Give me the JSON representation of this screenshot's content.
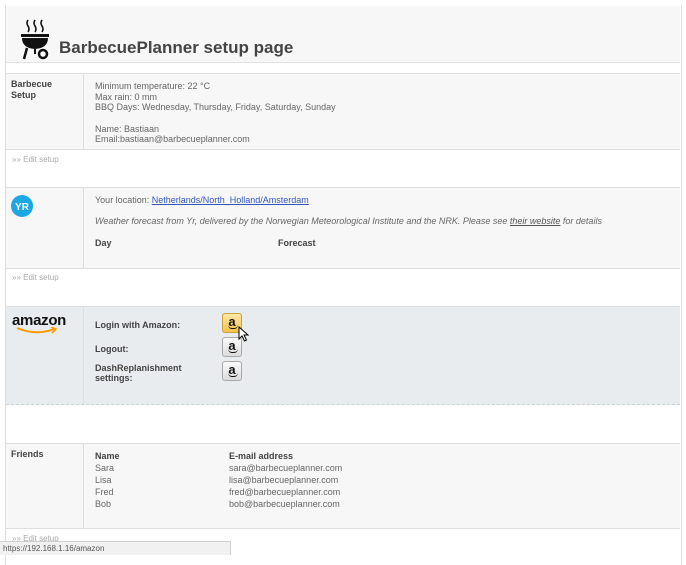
{
  "header": {
    "title": "BarbecuePlanner setup page",
    "icon": "grill-icon"
  },
  "barbecue": {
    "label": "Barbecue Setup",
    "min_temp": "Minimum temperature: 22 °C",
    "max_rain": "Max rain: 0 mm",
    "bbq_days": "BBQ Days: Wednesday, Thursday, Friday, Saturday, Sunday",
    "name": "Name: Bastiaan",
    "email": "Email:bastiaan@barbecueplanner.com",
    "edit_link": "»» Edit setup"
  },
  "weather": {
    "logo_text": "YR",
    "location_label": "Your location: ",
    "location_link": "Netherlands/North_Holland/Amsterdam",
    "forecast_text": "Weather forecast from Yr, delivered by the Norwegian Meteorological Institute and the NRK. Please see ",
    "website_link": "their website",
    "forecast_suffix": " for details",
    "col_day": "Day",
    "col_forecast": "Forecast",
    "edit_link": "»» Edit setup"
  },
  "amazon": {
    "logo_text": "amazon",
    "login_label": "Login with Amazon:",
    "logout_label": "Logout:",
    "dash_label": "DashReplanishment settings:",
    "button_glyph": "a"
  },
  "friends": {
    "label": "Friends",
    "col_name": "Name",
    "col_email": "E-mail address",
    "rows": [
      {
        "name": "Sara",
        "email": "sara@barbecueplanner.com"
      },
      {
        "name": "Lisa",
        "email": "lisa@barbecueplanner.com"
      },
      {
        "name": "Fred",
        "email": "fred@barbecueplanner.com"
      },
      {
        "name": "Bob",
        "email": "bob@barbecueplanner.com"
      }
    ],
    "edit_link": "»» Edit setup"
  },
  "status_bar": {
    "url": "https://192.168.1.16/amazon"
  },
  "colors": {
    "link": "#3355bb",
    "yr_blue": "#1aa7e4",
    "amazon_orange": "#f90",
    "amazon_row_bg": "#e8ecee"
  }
}
